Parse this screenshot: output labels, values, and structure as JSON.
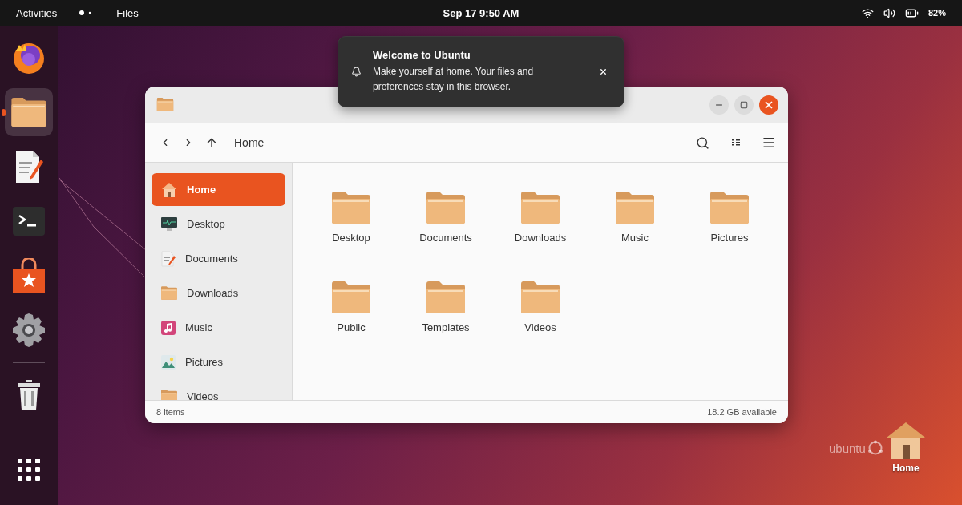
{
  "top_bar": {
    "activities": "Activities",
    "app_name": "Files",
    "clock": "Sep 17 9:50 AM",
    "battery": "82%"
  },
  "dock": [
    {
      "kind": "browser",
      "selected": false,
      "running": false
    },
    {
      "kind": "files",
      "selected": true,
      "running": true
    },
    {
      "kind": "editor",
      "selected": false,
      "running": false
    },
    {
      "kind": "terminal",
      "selected": false,
      "running": false
    },
    {
      "kind": "store",
      "selected": false,
      "running": false
    },
    {
      "kind": "settings",
      "selected": false,
      "running": false
    },
    {
      "kind": "separator"
    },
    {
      "kind": "trash",
      "selected": false,
      "running": false
    }
  ],
  "notification": {
    "title": "Welcome to Ubuntu",
    "body": "Make yourself at home. Your files and preferences stay in this browser."
  },
  "window": {
    "path": "Home",
    "sidebar": [
      {
        "label": "Home",
        "kind": "home",
        "selected": true
      },
      {
        "label": "Desktop",
        "kind": "desktop",
        "selected": false
      },
      {
        "label": "Documents",
        "kind": "documents",
        "selected": false
      },
      {
        "label": "Downloads",
        "kind": "folder",
        "selected": false
      },
      {
        "label": "Music",
        "kind": "music",
        "selected": false
      },
      {
        "label": "Pictures",
        "kind": "pictures",
        "selected": false
      },
      {
        "label": "Videos",
        "kind": "folder",
        "selected": false
      }
    ],
    "folders": [
      "Desktop",
      "Documents",
      "Downloads",
      "Music",
      "Pictures",
      "Public",
      "Templates",
      "Videos"
    ],
    "status_left": "8 items",
    "status_right": "18.2 GB available"
  },
  "desktop": {
    "logo": "ubuntu",
    "home_icon": "Home"
  }
}
